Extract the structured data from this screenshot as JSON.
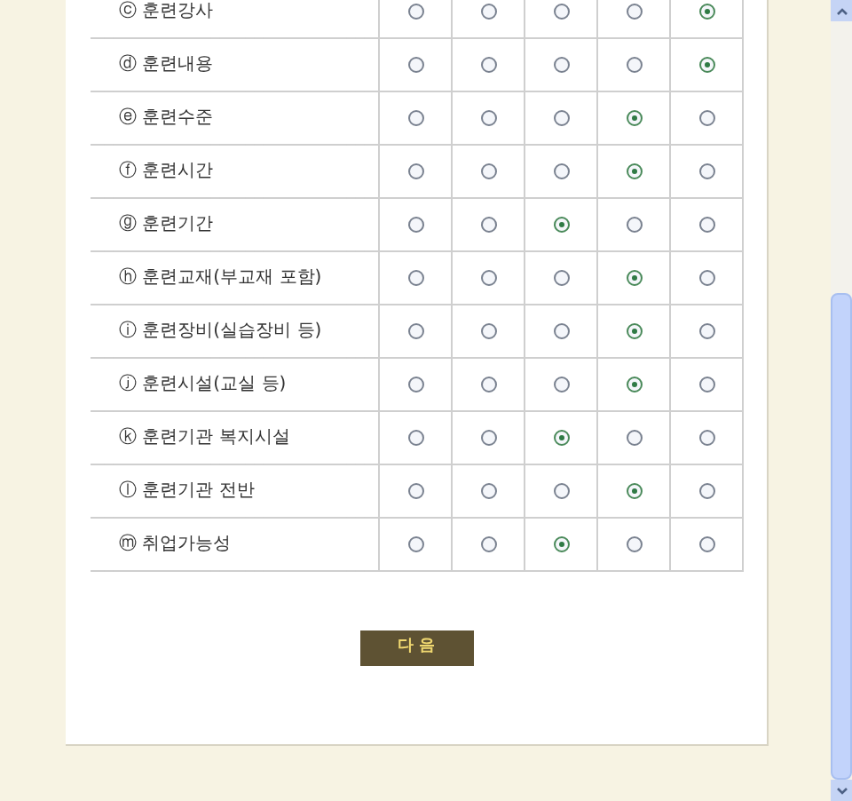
{
  "rows": [
    {
      "label": "ⓒ 훈련강사",
      "options": [
        {
          "selected": false
        },
        {
          "selected": false
        },
        {
          "selected": false
        },
        {
          "selected": false
        },
        {
          "selected": true
        }
      ]
    },
    {
      "label": "ⓓ 훈련내용",
      "options": [
        {
          "selected": false
        },
        {
          "selected": false
        },
        {
          "selected": false
        },
        {
          "selected": false
        },
        {
          "selected": true
        }
      ]
    },
    {
      "label": "ⓔ 훈련수준",
      "options": [
        {
          "selected": false
        },
        {
          "selected": false
        },
        {
          "selected": false
        },
        {
          "selected": true
        },
        {
          "selected": false
        }
      ]
    },
    {
      "label": "ⓕ 훈련시간",
      "options": [
        {
          "selected": false
        },
        {
          "selected": false
        },
        {
          "selected": false
        },
        {
          "selected": true
        },
        {
          "selected": false
        }
      ]
    },
    {
      "label": "ⓖ 훈련기간",
      "options": [
        {
          "selected": false
        },
        {
          "selected": false
        },
        {
          "selected": true
        },
        {
          "selected": false
        },
        {
          "selected": false
        }
      ]
    },
    {
      "label": "ⓗ 훈련교재(부교재 포함)",
      "options": [
        {
          "selected": false
        },
        {
          "selected": false
        },
        {
          "selected": false
        },
        {
          "selected": true
        },
        {
          "selected": false
        }
      ]
    },
    {
      "label": "ⓘ 훈련장비(실습장비 등)",
      "options": [
        {
          "selected": false
        },
        {
          "selected": false
        },
        {
          "selected": false
        },
        {
          "selected": true
        },
        {
          "selected": false
        }
      ]
    },
    {
      "label": "ⓙ 훈련시설(교실 등)",
      "options": [
        {
          "selected": false
        },
        {
          "selected": false
        },
        {
          "selected": false
        },
        {
          "selected": true
        },
        {
          "selected": false
        }
      ]
    },
    {
      "label": "ⓚ 훈련기관 복지시설",
      "options": [
        {
          "selected": false
        },
        {
          "selected": false
        },
        {
          "selected": true
        },
        {
          "selected": false
        },
        {
          "selected": false
        }
      ]
    },
    {
      "label": "ⓛ 훈련기관 전반",
      "options": [
        {
          "selected": false
        },
        {
          "selected": false
        },
        {
          "selected": false
        },
        {
          "selected": true
        },
        {
          "selected": false
        }
      ]
    },
    {
      "label": "ⓜ 취업가능성",
      "options": [
        {
          "selected": false
        },
        {
          "selected": false
        },
        {
          "selected": true
        },
        {
          "selected": false
        },
        {
          "selected": false
        }
      ]
    }
  ],
  "next_button": "다 음"
}
